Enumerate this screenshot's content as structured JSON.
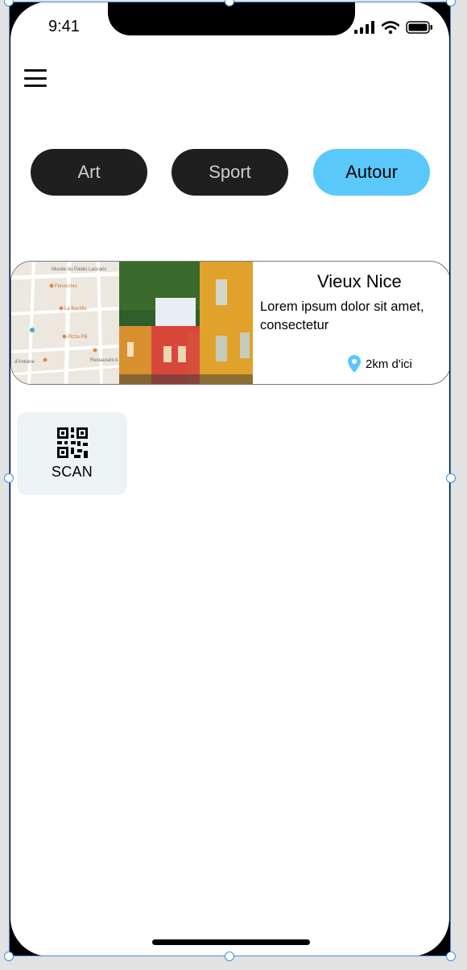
{
  "status_bar": {
    "time": "9:41"
  },
  "header": {
    "menu_icon": "hamburger-icon"
  },
  "filters": [
    {
      "label": "Art",
      "active": false
    },
    {
      "label": "Sport",
      "active": false
    },
    {
      "label": "Autour",
      "active": true
    }
  ],
  "card": {
    "title": "Vieux Nice",
    "description": "Lorem ipsum dolor sit amet, consectetur",
    "distance": "2km d'ici",
    "map_labels": [
      "Musée du Palais Lascaris",
      "Fenocchio",
      "La Bastille",
      "Pizza Pili",
      "Restaurant A",
      "d'Antoine"
    ],
    "pin_icon": "location-pin-icon"
  },
  "scan": {
    "label": "SCAN",
    "icon": "qr-code-icon"
  },
  "colors": {
    "accent": "#5ac8fa",
    "pill_dark": "#1f1f1f",
    "scan_bg": "#edf2f5"
  }
}
